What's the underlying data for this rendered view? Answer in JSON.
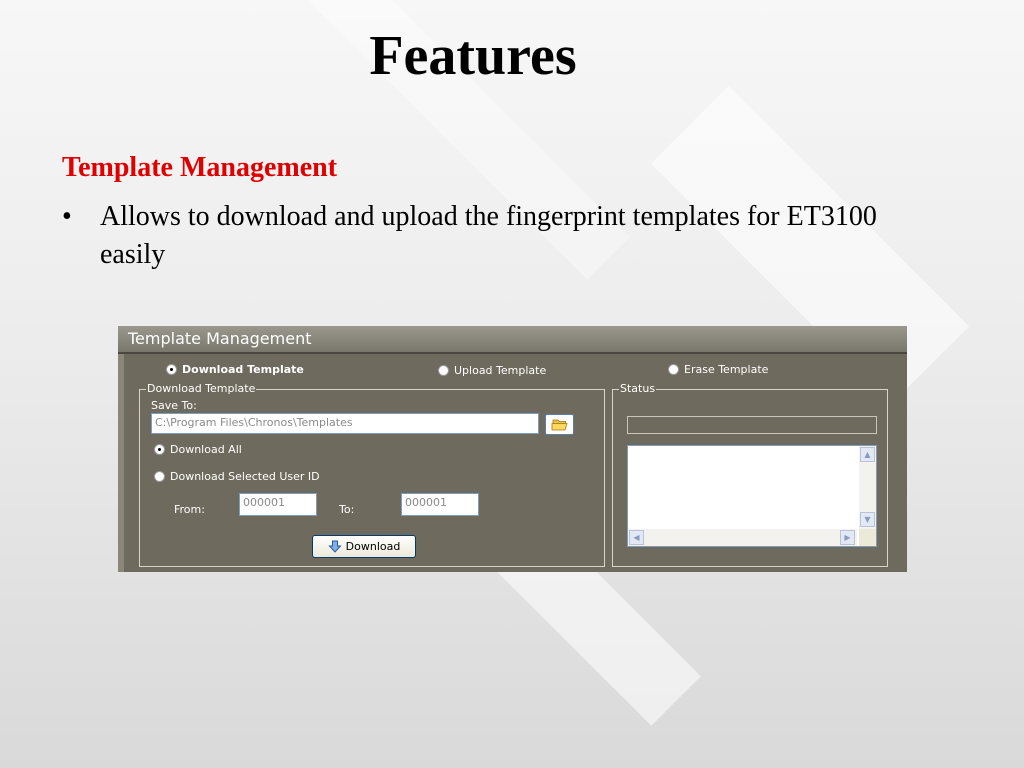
{
  "slide": {
    "title": "Features",
    "subheading": "Template Management",
    "bullet_symbol": "•",
    "bullet_text": "Allows to download and upload the fingerprint templates for ET3100 easily"
  },
  "app": {
    "window_title": "Template Management",
    "mode_options": [
      {
        "label": "Download Template",
        "selected": true
      },
      {
        "label": "Upload Template",
        "selected": false
      },
      {
        "label": "Erase Template",
        "selected": false
      }
    ],
    "download_group": {
      "label": "Download Template",
      "save_to_label": "Save To:",
      "save_to_value": "C:\\Program Files\\Chronos\\Templates",
      "folder_icon": "folder-open-icon",
      "options": [
        {
          "label": "Download All",
          "selected": true
        },
        {
          "label": "Download Selected User ID",
          "selected": false
        }
      ],
      "from_label": "From:",
      "from_value": "000001",
      "to_label": "To:",
      "to_value": "000001",
      "download_button": "Download",
      "download_icon": "arrow-down-icon"
    },
    "status_group": {
      "label": "Status",
      "progress": 0
    }
  }
}
